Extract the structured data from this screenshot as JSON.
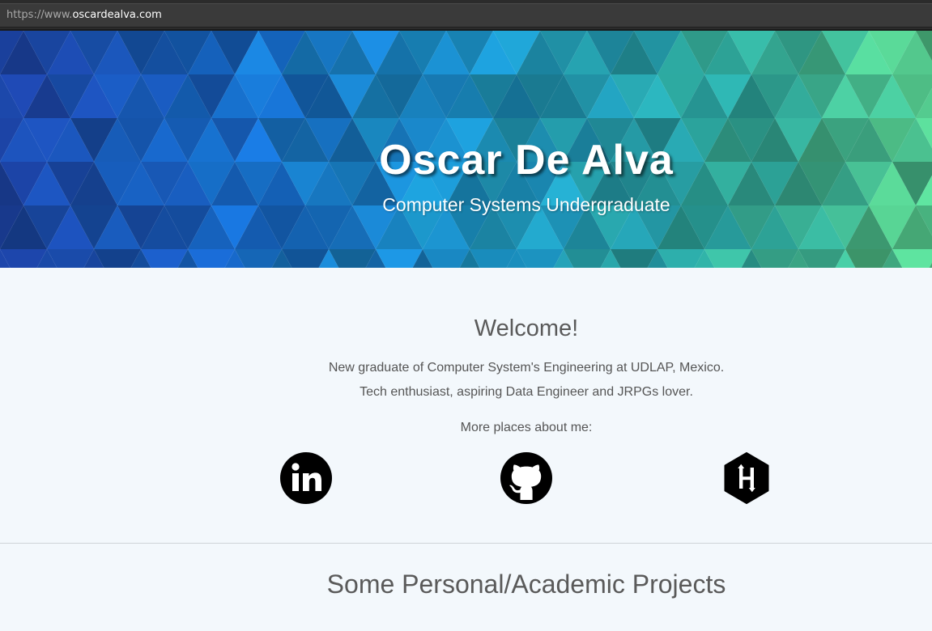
{
  "browser": {
    "url_scheme": "https://www.",
    "url_host": "oscardealva.com"
  },
  "hero": {
    "title": "Oscar De Alva",
    "subtitle": "Computer Systems Undergraduate"
  },
  "welcome": {
    "title": "Welcome!",
    "line1": "New graduate of Computer System's Engineering at UDLAP, Mexico.",
    "line2": "Tech enthusiast, aspiring Data Engineer and JRPGs lover.",
    "more_places": "More places about me:"
  },
  "social_links": [
    {
      "icon": "linkedin-icon"
    },
    {
      "icon": "github-icon"
    },
    {
      "icon": "hackerrank-icon"
    }
  ],
  "projects": {
    "title": "Some Personal/Academic Projects"
  },
  "colors": {
    "page_background": "#f3f8fc",
    "heading_text": "#5a5a5a",
    "body_text": "#555555",
    "hero_blue": "#1a3f9a",
    "hero_teal": "#2aa19a",
    "hero_green": "#4fbf86"
  }
}
